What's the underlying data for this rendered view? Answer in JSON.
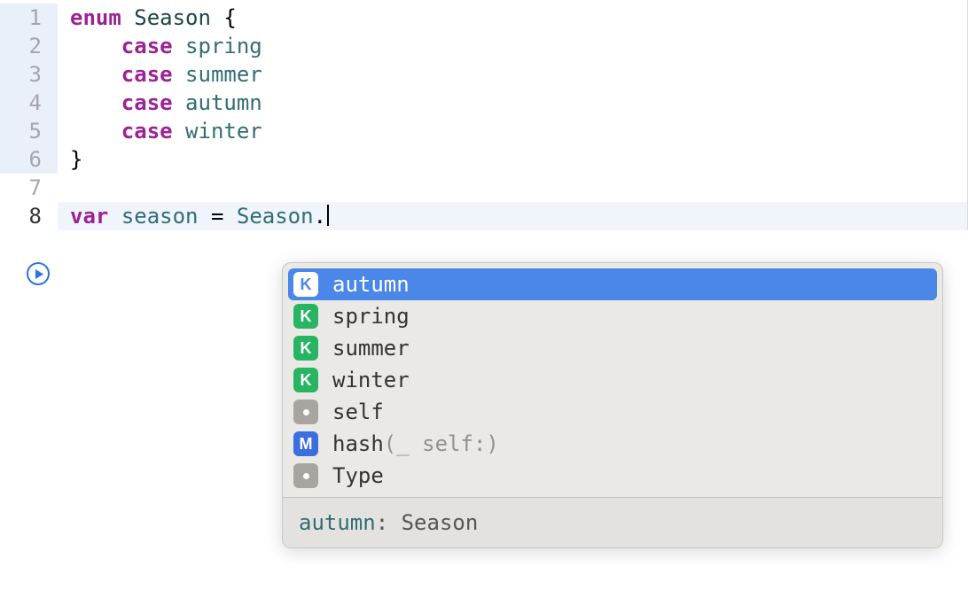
{
  "gutter": {
    "lines": [
      "1",
      "2",
      "3",
      "4",
      "5",
      "6",
      "7",
      "8"
    ]
  },
  "code": {
    "l1": {
      "kw": "enum",
      "name": "Season",
      "brace": "{"
    },
    "l2": {
      "kw": "case",
      "name": "spring"
    },
    "l3": {
      "kw": "case",
      "name": "summer"
    },
    "l4": {
      "kw": "case",
      "name": "autumn"
    },
    "l5": {
      "kw": "case",
      "name": "winter"
    },
    "l6": {
      "brace": "}"
    },
    "l8": {
      "kw": "var",
      "name": "season",
      "eq": " = ",
      "type": "Season",
      "dot": "."
    }
  },
  "completion": {
    "items": {
      "i0": {
        "kind": "K",
        "label": "autumn"
      },
      "i1": {
        "kind": "K",
        "label": "spring"
      },
      "i2": {
        "kind": "K",
        "label": "summer"
      },
      "i3": {
        "kind": "K",
        "label": "winter"
      },
      "i4": {
        "kind": "dot",
        "label": "self"
      },
      "i5": {
        "kind": "M",
        "label_main": "hash",
        "label_dim": "(_ self:)"
      },
      "i6": {
        "kind": "dot",
        "label": "Type"
      }
    },
    "detail": {
      "name": "autumn",
      "sep": ": ",
      "type": "Season"
    }
  }
}
